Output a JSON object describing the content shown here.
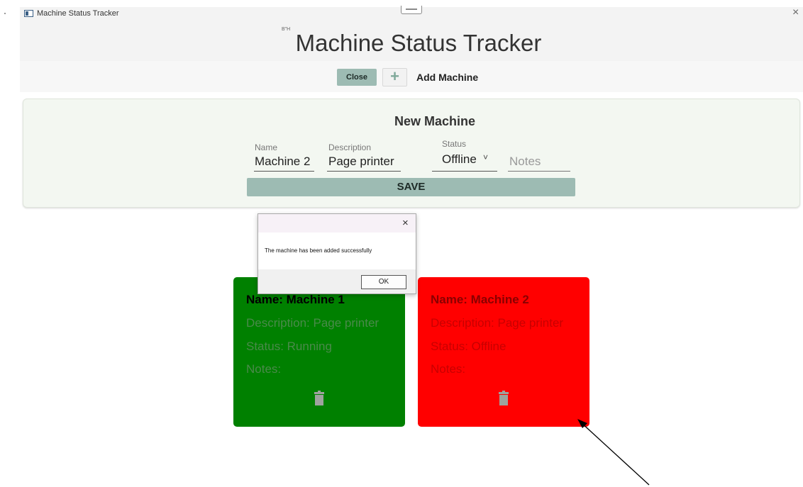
{
  "window": {
    "title": "Machine Status Tracker",
    "close_glyph": "×"
  },
  "header": {
    "small_mark": "B\"H",
    "title": "Machine Status Tracker"
  },
  "toolbar": {
    "close_label": "Close",
    "plus_glyph": "+",
    "add_machine_label": "Add Machine"
  },
  "form": {
    "heading": "New Machine",
    "name_label": "Name",
    "name_value": "Machine 2",
    "description_label": "Description",
    "description_value": "Page printer",
    "status_label": "Status",
    "status_value": "Offline",
    "status_chevron": "˅",
    "notes_placeholder": "Notes",
    "save_label": "SAVE"
  },
  "dialog": {
    "close_glyph": "×",
    "message": "The machine has been added successfully",
    "ok_label": "OK"
  },
  "cards": [
    {
      "name": "Name: Machine 1",
      "description": "Description: Page printer",
      "status": "Status: Running",
      "notes": "Notes:",
      "color": "#008000"
    },
    {
      "name": "Name: Machine 2",
      "description": "Description: Page printer",
      "status": "Status: Offline",
      "notes": "Notes:",
      "color": "#ff0000"
    }
  ],
  "colors": {
    "accent": "#9dbbb3",
    "running": "#008000",
    "offline": "#ff0000"
  }
}
